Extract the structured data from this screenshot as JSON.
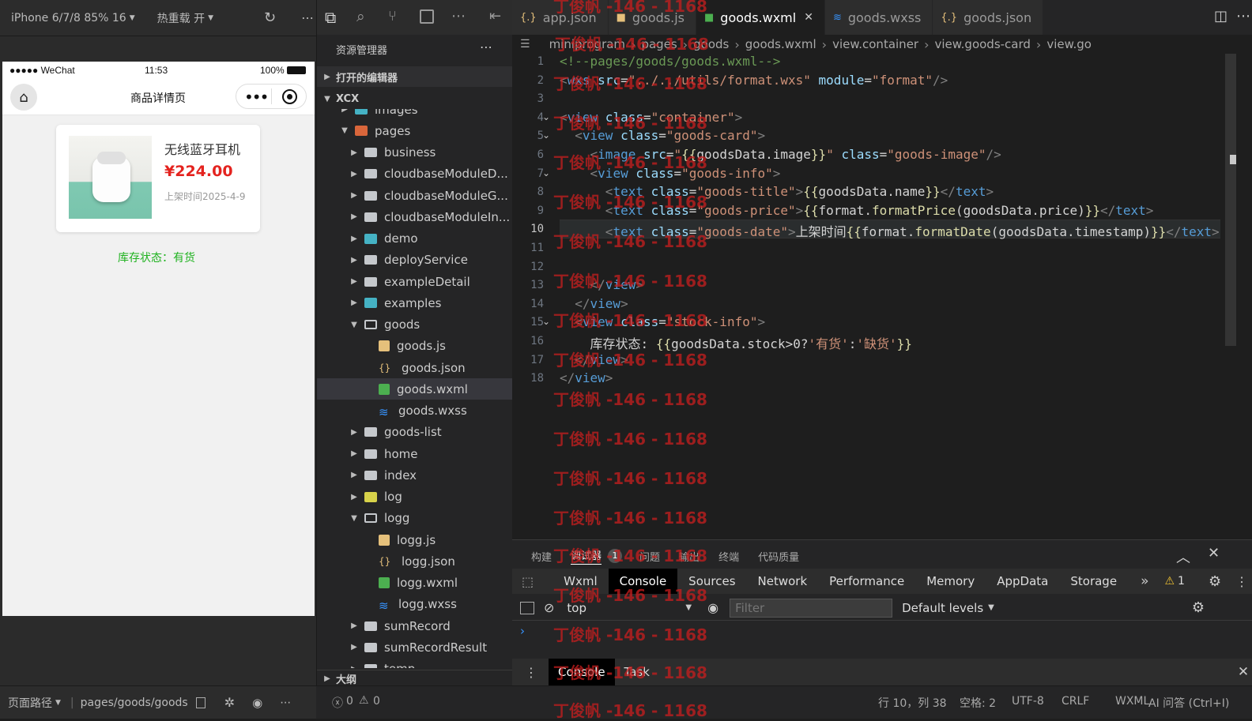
{
  "simulator": {
    "device_label": "iPhone 6/7/8 85% 16",
    "hot_reload_label": "热重载 开",
    "status": {
      "carrier": "●●●●● WeChat",
      "time": "11:53",
      "battery": "100%"
    },
    "nav_title": "商品详情页",
    "product": {
      "name": "无线蓝牙耳机",
      "price": "¥224.00",
      "date": "上架时间2025-4-9"
    },
    "stock_text": "库存状态：有货",
    "bottom": {
      "path_label": "页面路径",
      "path": "pages/goods/goods"
    }
  },
  "explorer": {
    "title": "资源管理器",
    "open_editors": "打开的编辑器",
    "project": "XCX",
    "outline": "大纲",
    "items": [
      {
        "label": "images",
        "depth": 1,
        "type": "folder-img",
        "chev": "closed"
      },
      {
        "label": "pages",
        "depth": 1,
        "type": "folder-open-orange",
        "chev": "open"
      },
      {
        "label": "business",
        "depth": 2,
        "type": "folder",
        "chev": "closed"
      },
      {
        "label": "cloudbaseModuleD...",
        "depth": 2,
        "type": "folder",
        "chev": "closed"
      },
      {
        "label": "cloudbaseModuleG...",
        "depth": 2,
        "type": "folder",
        "chev": "closed"
      },
      {
        "label": "cloudbaseModuleIn...",
        "depth": 2,
        "type": "folder",
        "chev": "closed"
      },
      {
        "label": "demo",
        "depth": 2,
        "type": "folder-img",
        "chev": "closed"
      },
      {
        "label": "deployService",
        "depth": 2,
        "type": "folder",
        "chev": "closed"
      },
      {
        "label": "exampleDetail",
        "depth": 2,
        "type": "folder",
        "chev": "closed"
      },
      {
        "label": "examples",
        "depth": 2,
        "type": "folder-img",
        "chev": "closed"
      },
      {
        "label": "goods",
        "depth": 2,
        "type": "folder-open",
        "chev": "open"
      },
      {
        "label": "goods.js",
        "depth": 3,
        "type": "js",
        "chev": ""
      },
      {
        "label": "goods.json",
        "depth": 3,
        "type": "json",
        "chev": ""
      },
      {
        "label": "goods.wxml",
        "depth": 3,
        "type": "wxml",
        "chev": "",
        "selected": true
      },
      {
        "label": "goods.wxss",
        "depth": 3,
        "type": "wxss",
        "chev": ""
      },
      {
        "label": "goods-list",
        "depth": 2,
        "type": "folder",
        "chev": "closed"
      },
      {
        "label": "home",
        "depth": 2,
        "type": "folder",
        "chev": "closed"
      },
      {
        "label": "index",
        "depth": 2,
        "type": "folder",
        "chev": "closed"
      },
      {
        "label": "log",
        "depth": 2,
        "type": "folder-log",
        "chev": "closed"
      },
      {
        "label": "logg",
        "depth": 2,
        "type": "folder-open",
        "chev": "open"
      },
      {
        "label": "logg.js",
        "depth": 3,
        "type": "js",
        "chev": ""
      },
      {
        "label": "logg.json",
        "depth": 3,
        "type": "json",
        "chev": ""
      },
      {
        "label": "logg.wxml",
        "depth": 3,
        "type": "wxml",
        "chev": ""
      },
      {
        "label": "logg.wxss",
        "depth": 3,
        "type": "wxss",
        "chev": ""
      },
      {
        "label": "sumRecord",
        "depth": 2,
        "type": "folder",
        "chev": "closed"
      },
      {
        "label": "sumRecordResult",
        "depth": 2,
        "type": "folder",
        "chev": "closed"
      },
      {
        "label": "temp",
        "depth": 2,
        "type": "folder",
        "chev": "closed"
      }
    ],
    "errors": "0",
    "warnings": "0"
  },
  "editor": {
    "tabs": [
      {
        "label": "app.json",
        "type": "json"
      },
      {
        "label": "goods.js",
        "type": "js"
      },
      {
        "label": "goods.wxml",
        "type": "wxml",
        "active": true
      },
      {
        "label": "goods.wxss",
        "type": "wxss"
      },
      {
        "label": "goods.json",
        "type": "json"
      }
    ],
    "breadcrumbs": [
      "miniprogram",
      "pages",
      "goods",
      "goods.wxml",
      "view.container",
      "view.goods-card",
      "view.go"
    ],
    "current_line": 10
  },
  "panel": {
    "tabs": [
      "构建",
      "调试器",
      "问题",
      "输出",
      "终端",
      "代码质量"
    ],
    "debugger_badge": "1",
    "devtabs": [
      "Wxml",
      "Console",
      "Sources",
      "Network",
      "Performance",
      "Memory",
      "AppData",
      "Storage"
    ],
    "warning_count": "1",
    "context": "top",
    "filter_placeholder": "Filter",
    "levels": "Default levels",
    "drawer_tabs": [
      "Console",
      "Task"
    ]
  },
  "statusbar": {
    "position": "行 10，列 38",
    "spaces": "空格: 2",
    "encoding": "UTF-8",
    "eol": "CRLF",
    "language": "WXML",
    "ai": "AI 问答 (Ctrl+I)"
  },
  "watermark": "丁俊帆 -146 - 1168"
}
